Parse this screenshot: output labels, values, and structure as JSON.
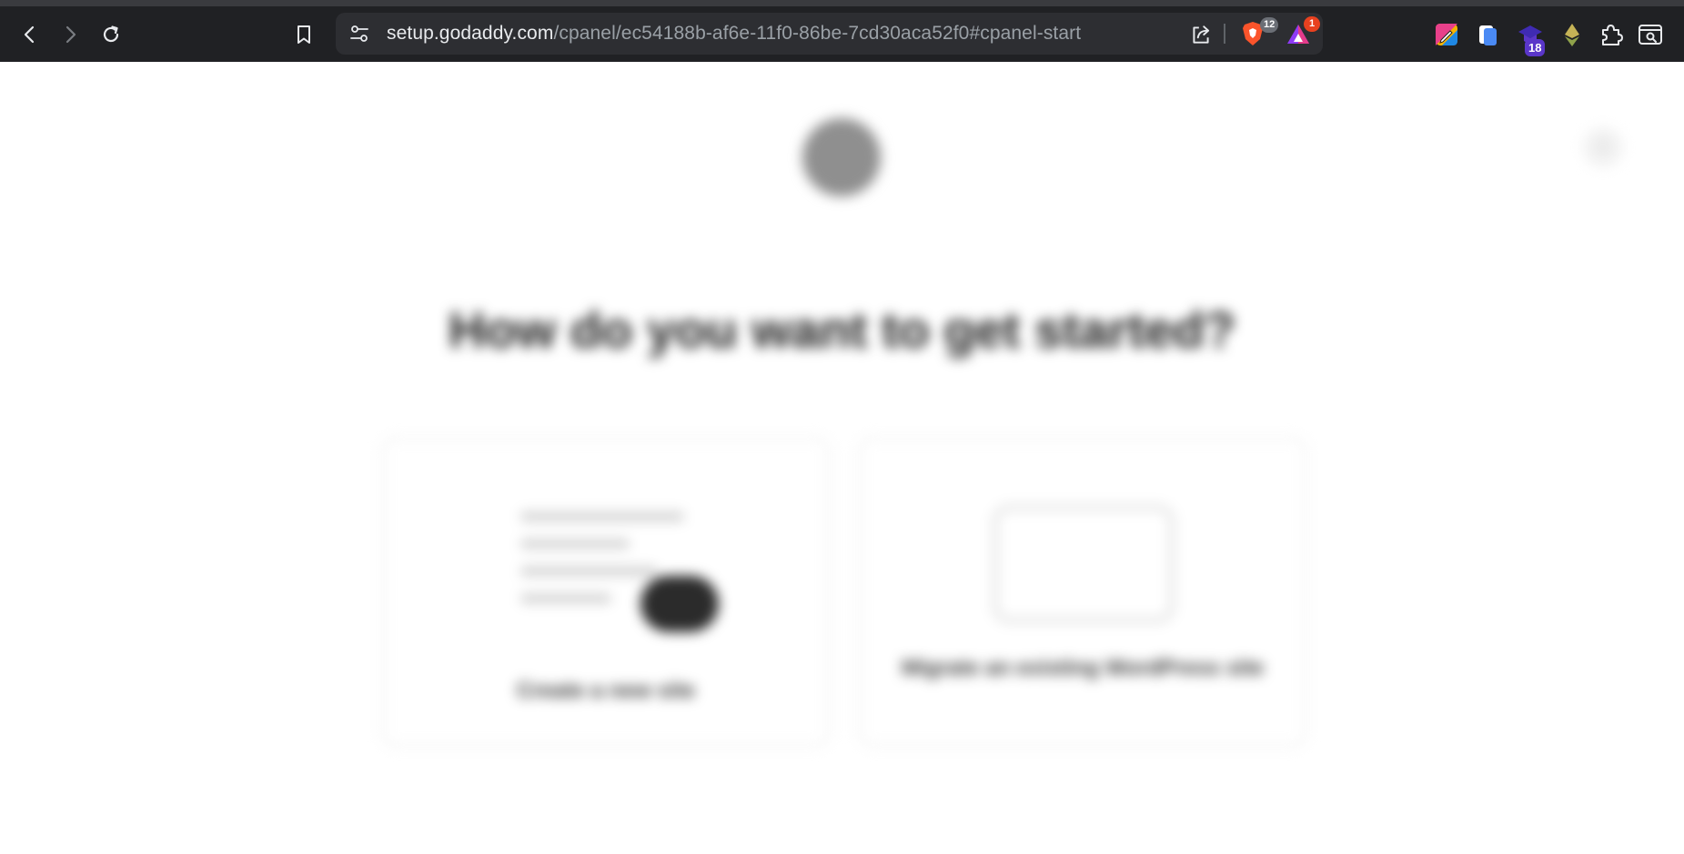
{
  "browser": {
    "url_host": "setup.godaddy.com",
    "url_path": "/cpanel/ec54188b-af6e-11f0-86be-7cd30aca52f0#cpanel-start",
    "shield_count": "12",
    "rewards_count": "1",
    "extension_count": "18",
    "icons": [
      "back-icon",
      "forward-icon",
      "reload-icon",
      "bookmark-icon",
      "site-settings-icon",
      "share-icon",
      "brave-shields-icon",
      "brave-rewards-icon",
      "color-picker-extension-icon",
      "clipboard-extension-icon",
      "graduation-cap-extension-icon",
      "ethereum-extension-icon",
      "extensions-puzzle-icon",
      "tab-search-icon"
    ],
    "colors": {
      "toolbar": "#202124",
      "omnibox": "#2d2e32",
      "url_host": "#e8eaed",
      "url_path": "#9aa0a6"
    }
  },
  "page": {
    "blurred": true,
    "close_label": "×",
    "heading": "How do you want to get started?",
    "cards": [
      {
        "label": "Create a new site"
      },
      {
        "label": "Migrate an existing WordPress site"
      }
    ]
  }
}
